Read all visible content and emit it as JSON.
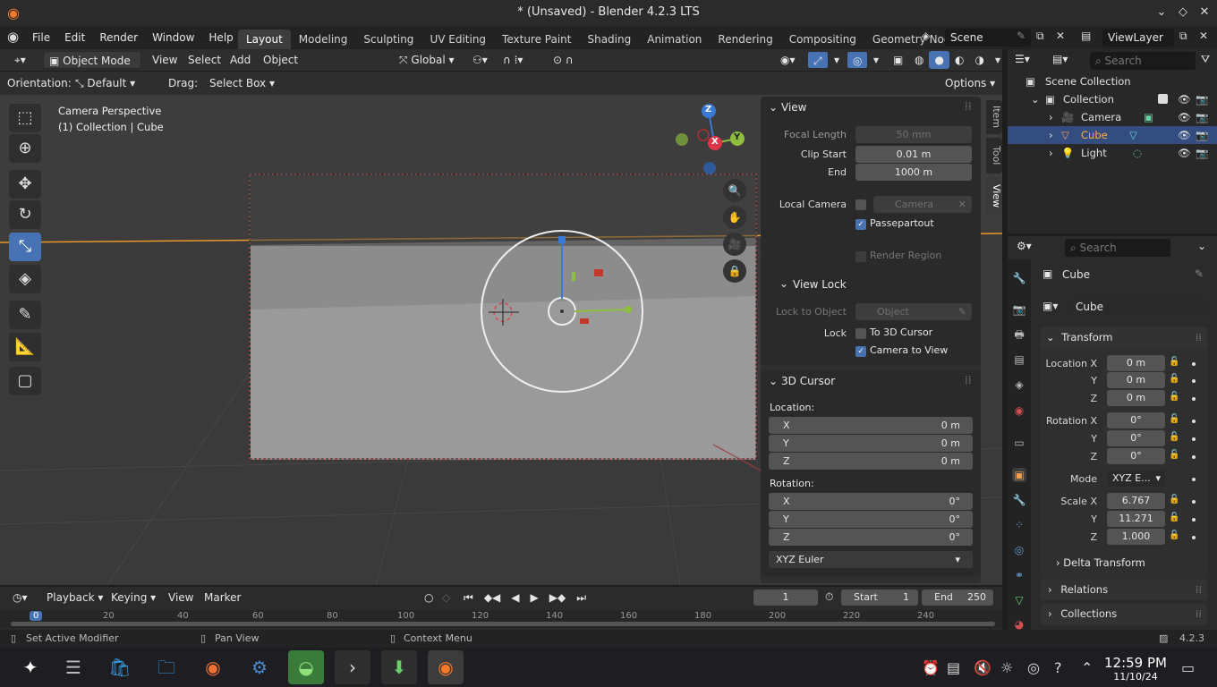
{
  "window": {
    "title": "* (Unsaved) - Blender 4.2.3 LTS"
  },
  "menu": [
    "File",
    "Edit",
    "Render",
    "Window",
    "Help"
  ],
  "workspaces": [
    "Layout",
    "Modeling",
    "Sculpting",
    "UV Editing",
    "Texture Paint",
    "Shading",
    "Animation",
    "Rendering",
    "Compositing",
    "Geometry Nod"
  ],
  "active_workspace": "Layout",
  "scene": "Scene",
  "view_layer": "ViewLayer",
  "viewport_header": {
    "mode": "Object Mode",
    "menus": [
      "View",
      "Select",
      "Add",
      "Object"
    ],
    "transform_orientation": "Global",
    "orientation_label": "Orientation:",
    "orientation_value": "Default",
    "drag_label": "Drag:",
    "drag_value": "Select Box",
    "options": "Options"
  },
  "viewport": {
    "line1": "Camera Perspective",
    "line2": "(1) Collection | Cube"
  },
  "gizmo": {
    "x": "X",
    "y": "Y",
    "z": "Z"
  },
  "npanel": {
    "tabs": [
      "Item",
      "Tool",
      "View"
    ],
    "view_header": "View",
    "focal_length_label": "Focal Length",
    "focal_length": "50 mm",
    "clip_start_label": "Clip Start",
    "clip_start": "0.01 m",
    "clip_end_label": "End",
    "clip_end": "1000 m",
    "local_camera_label": "Local Camera",
    "local_camera_value": "Camera",
    "passepartout": "Passepartout",
    "render_region": "Render Region",
    "view_lock_header": "View Lock",
    "lock_to_object_label": "Lock to Object",
    "lock_to_object_placeholder": "Object",
    "lock_label": "Lock",
    "to_3d_cursor": "To 3D Cursor",
    "camera_to_view": "Camera to View",
    "cursor_header": "3D Cursor",
    "location_label": "Location:",
    "loc_x": "0 m",
    "loc_y": "0 m",
    "loc_z": "0 m",
    "rotation_label": "Rotation:",
    "rot_x": "0°",
    "rot_y": "0°",
    "rot_z": "0°",
    "rotation_mode": "XYZ Euler",
    "axis_x": "X",
    "axis_y": "Y",
    "axis_z": "Z"
  },
  "outliner": {
    "search_placeholder": "Search",
    "scene_collection": "Scene Collection",
    "collection": "Collection",
    "items": [
      "Camera",
      "Cube",
      "Light"
    ]
  },
  "properties": {
    "search_placeholder": "Search",
    "object_name": "Cube",
    "data_name": "Cube",
    "transform_header": "Transform",
    "location_x_label": "Location X",
    "loc_x": "0 m",
    "loc_y": "0 m",
    "loc_z": "0 m",
    "rotation_x_label": "Rotation X",
    "rot_x": "0°",
    "rot_y": "0°",
    "rot_z": "0°",
    "mode_label": "Mode",
    "mode_value": "XYZ E...",
    "scale_x_label": "Scale X",
    "scale_x": "6.767",
    "scale_y": "11.271",
    "scale_z": "1.000",
    "y_label": "Y",
    "z_label": "Z",
    "delta_transform": "Delta Transform",
    "relations": "Relations",
    "collections": "Collections"
  },
  "timeline": {
    "menus": [
      "Playback",
      "Keying",
      "View",
      "Marker"
    ],
    "current_frame": "1",
    "start_label": "Start",
    "start": "1",
    "end_label": "End",
    "end": "250",
    "ruler": [
      "0",
      "20",
      "40",
      "60",
      "80",
      "100",
      "120",
      "140",
      "160",
      "180",
      "200",
      "220",
      "240"
    ]
  },
  "statusbar": {
    "left": "Set Active Modifier",
    "middle": "Pan View",
    "right": "Context Menu",
    "version": "4.2.3"
  },
  "taskbar": {
    "time": "12:59 PM",
    "date": "11/10/24"
  },
  "colors": {
    "accent": "#4772b3",
    "selected_row": "#334d80",
    "x_axis": "#e0344a",
    "y_axis": "#8fbd3d",
    "z_axis": "#3a79d6"
  }
}
